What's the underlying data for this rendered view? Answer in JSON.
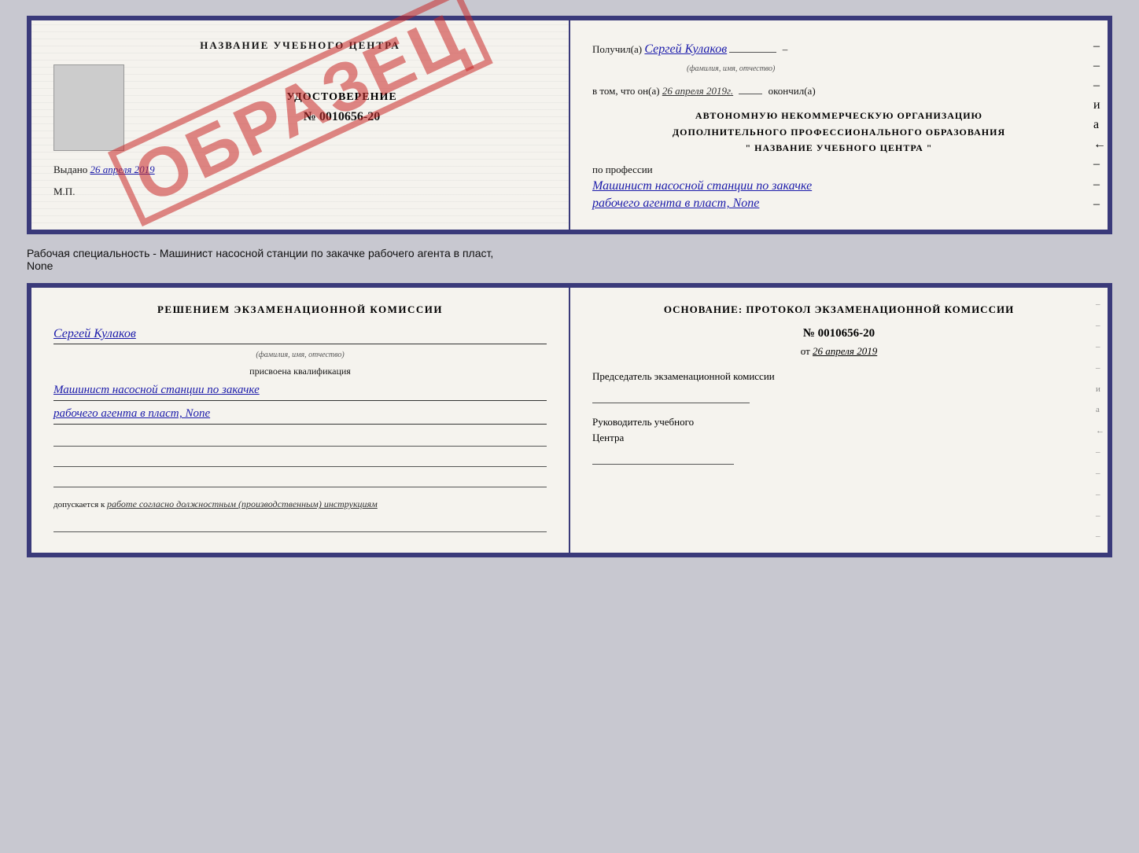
{
  "top_document": {
    "left": {
      "center_title": "НАЗВАНИЕ УЧЕБНОГО ЦЕНТРА",
      "obrazets": "ОБРАЗЕЦ",
      "cert_title": "УДОСТОВЕРЕНИЕ",
      "cert_number": "№ 0010656-20",
      "vydano_label": "Выдано",
      "vydano_date": "26 апреля 2019",
      "mp": "М.П."
    },
    "right": {
      "poluchil_label": "Получил(а)",
      "poluchil_value": "Сергей Кулаков",
      "poluchil_hint": "(фамилия, имя, отчество)",
      "vtom_label": "в том, что он(а)",
      "vtom_date": "26 апреля 2019г.",
      "okonchil_label": "окончил(а)",
      "org_line1": "АВТОНОМНУЮ НЕКОММЕРЧЕСКУЮ ОРГАНИЗАЦИЮ",
      "org_line2": "ДОПОЛНИТЕЛЬНОГО ПРОФЕССИОНАЛЬНОГО ОБРАЗОВАНИЯ",
      "org_line3": "\"   НАЗВАНИЕ УЧЕБНОГО ЦЕНТРА   \"",
      "profession_label": "по профессии",
      "profession_value1": "Машинист насосной станции по закачке",
      "profession_value2": "рабочего агента в пласт, None",
      "side_marks": [
        "-",
        "-",
        "-",
        "и",
        "а",
        "←",
        "-",
        "-",
        "-"
      ]
    }
  },
  "caption": {
    "text1": "Рабочая специальность - Машинист насосной станции по закачке рабочего агента в пласт,",
    "text2": "None"
  },
  "bottom_document": {
    "left": {
      "section_title": "Решением экзаменационной комиссии",
      "name_value": "Сергей Кулаков",
      "name_hint": "(фамилия, имя, отчество)",
      "assigned_text": "присвоена квалификация",
      "qualification1": "Машинист насосной станции по закачке",
      "qualification2": "рабочего агента в пласт, None",
      "sign_lines": [
        "",
        "",
        ""
      ],
      "допускается_label": "допускается к",
      "допускается_value": "работе согласно должностным (производственным) инструкциям",
      "bottom_line": ""
    },
    "right": {
      "osnование_label": "Основание: протокол экзаменационной комиссии",
      "protocol_number": "№ 0010656-20",
      "protocol_date_prefix": "от",
      "protocol_date": "26 апреля 2019",
      "predsedatel_label": "Председатель экзаменационной комиссии",
      "sign_line1": "",
      "rukovoditel_label": "Руководитель учебного",
      "tsentra_label": "Центра",
      "sign_line2": "",
      "side_marks": [
        "-",
        "-",
        "-",
        "-",
        "и",
        "а",
        "←",
        "-",
        "-",
        "-",
        "-",
        "-"
      ]
    }
  }
}
